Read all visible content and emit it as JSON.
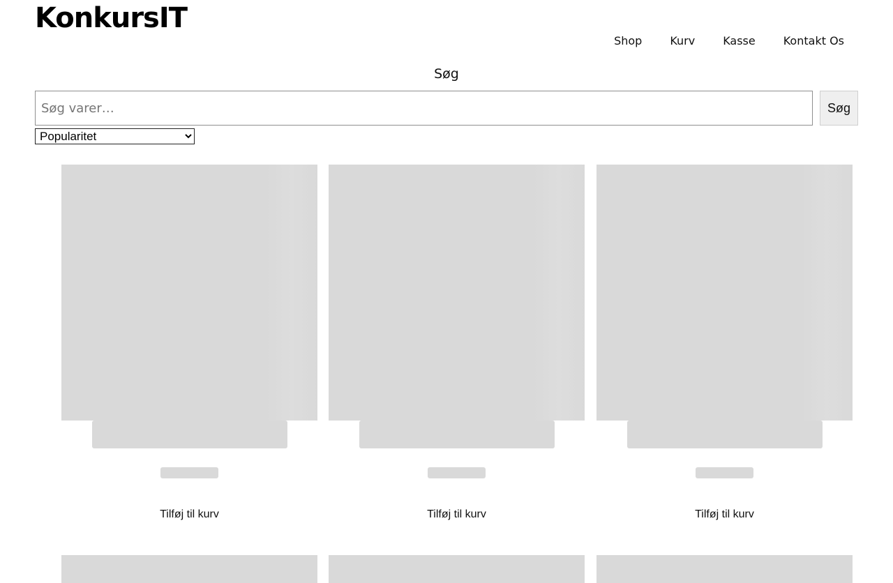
{
  "header": {
    "logo": "KonkursIT",
    "nav": [
      {
        "label": "Shop"
      },
      {
        "label": "Kurv"
      },
      {
        "label": "Kasse"
      },
      {
        "label": "Kontakt Os"
      }
    ]
  },
  "search": {
    "heading": "Søg",
    "placeholder": "Søg varer…",
    "value": "",
    "button_label": "Søg"
  },
  "sort": {
    "selected": "Popularitet"
  },
  "products": [
    {
      "add_label": "Tilføj til kurv",
      "loading": true
    },
    {
      "add_label": "Tilføj til kurv",
      "loading": true
    },
    {
      "add_label": "Tilføj til kurv",
      "loading": true
    }
  ],
  "colors": {
    "skeleton": "#d9d9d9",
    "text": "#111111",
    "background": "#ffffff"
  }
}
